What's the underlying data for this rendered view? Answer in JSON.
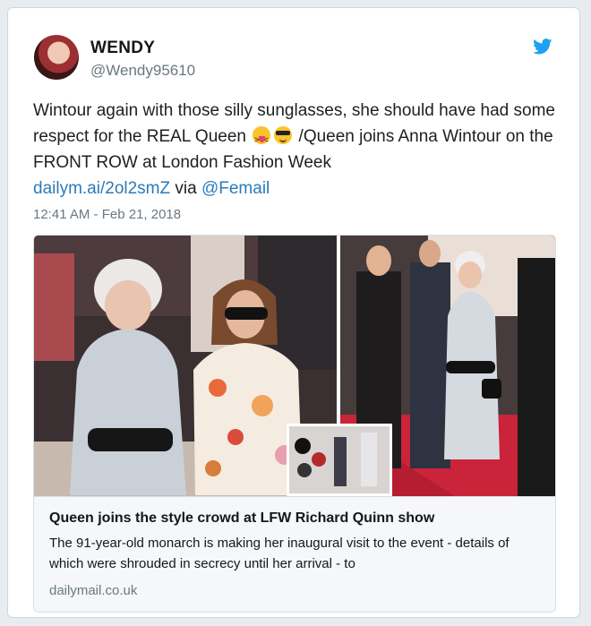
{
  "author": {
    "name": "WENDY",
    "handle": "@Wendy95610"
  },
  "tweet": {
    "text_part1": "Wintour again with those silly sunglasses, she should have had some respect for the REAL Queen ",
    "text_part2": " /Queen joins Anna Wintour on the FRONT ROW at London Fashion Week ",
    "link": "dailym.ai/2ol2smZ",
    "via": " via ",
    "mention": "@Femail",
    "emojis": [
      "squinting-face-with-tongue-emoji",
      "smiling-face-with-sunglasses-emoji"
    ],
    "timestamp": "12:41 AM - Feb 21, 2018"
  },
  "card": {
    "title": "Queen joins the style crowd at LFW Richard Quinn show",
    "description": "The 91-year-old monarch is making her inaugural visit to the event - details of which were shrouded in secrecy until her arrival - to",
    "domain": "dailymail.co.uk"
  },
  "colors": {
    "link": "#2b7bb9",
    "twitter_blue": "#1da1f2",
    "muted": "#697882"
  }
}
